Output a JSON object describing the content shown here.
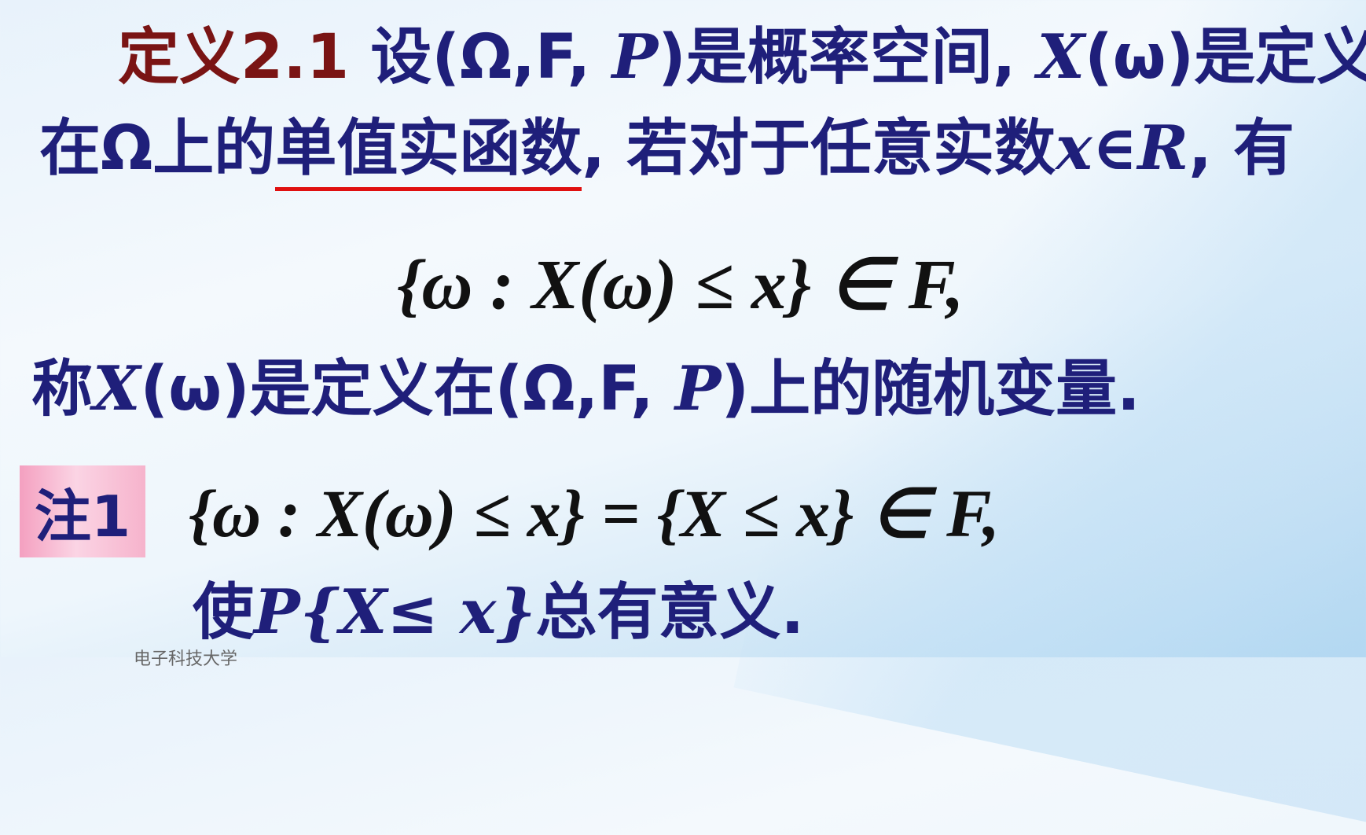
{
  "line1": {
    "label": "定义2.1",
    "text_a": " 设(Ω,F, ",
    "p": "P",
    "text_b": ")是概率空间, ",
    "x": "X",
    "text_c": "(ω)是定义"
  },
  "line2": {
    "text_a": "在Ω上的",
    "underlined": "单值实函数",
    "text_b": ", 若对于任意实数",
    "math": "x∈R",
    "text_c": ", 有"
  },
  "formula1": "{ω : X(ω) ≤ x} ∈ F,",
  "line3": {
    "text_a": "称",
    "x": "X",
    "text_b": "(ω)是定义在(Ω,F, ",
    "p": "P",
    "text_c": ")上的随机变量."
  },
  "note": {
    "label": "注1",
    "formula": "{ω : X(ω) ≤ x} = {X ≤ x} ∈ F,",
    "text_a": "使",
    "math": "P{X≤ x}",
    "text_b": "总有意义."
  },
  "footer": "电子科技大学"
}
